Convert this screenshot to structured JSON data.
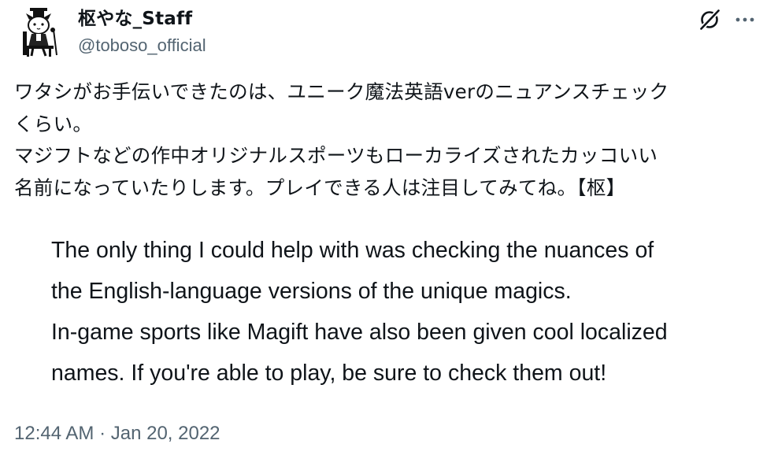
{
  "author": {
    "name": "枢やな_Staff",
    "handle": "@toboso_official"
  },
  "header_icons": [
    "grok-icon",
    "more-icon"
  ],
  "tweet": {
    "japanese_lines": [
      "ワタシがお手伝いできたのは、ユニーク魔法英語verのニュアンスチェック",
      "くらい。",
      "マジフトなどの作中オリジナルスポーツもローカライズされたカッコいい",
      "名前になっていたりします。プレイできる人は注目してみてね。【枢】"
    ],
    "english_lines": [
      "The only thing I could help with was checking the nuances of",
      "the English-language versions of the unique magics.",
      "In-game sports like Magift have also been given cool localized",
      "names. If you're able to play, be sure to check them out!"
    ],
    "timestamp": "12:44 AM · Jan 20, 2022"
  },
  "colors": {
    "text": "#0f1419",
    "secondary": "#536471"
  }
}
